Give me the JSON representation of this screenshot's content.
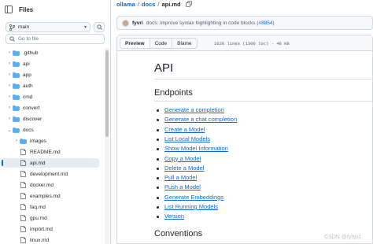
{
  "sidebar": {
    "title": "Files",
    "branch": "main",
    "goto_placeholder": "Go to file",
    "tree": [
      {
        "label": ".github",
        "type": "folder",
        "expanded": false,
        "indent": 0
      },
      {
        "label": "api",
        "type": "folder",
        "expanded": false,
        "indent": 0
      },
      {
        "label": "app",
        "type": "folder",
        "expanded": false,
        "indent": 0
      },
      {
        "label": "auth",
        "type": "folder",
        "expanded": false,
        "indent": 0
      },
      {
        "label": "cmd",
        "type": "folder",
        "expanded": false,
        "indent": 0
      },
      {
        "label": "convert",
        "type": "folder",
        "expanded": false,
        "indent": 0
      },
      {
        "label": "discover",
        "type": "folder",
        "expanded": false,
        "indent": 0
      },
      {
        "label": "docs",
        "type": "folder",
        "expanded": true,
        "indent": 0
      },
      {
        "label": "images",
        "type": "folder",
        "expanded": false,
        "indent": 1
      },
      {
        "label": "README.md",
        "type": "file",
        "indent": 1
      },
      {
        "label": "api.md",
        "type": "file",
        "indent": 1,
        "selected": true
      },
      {
        "label": "development.md",
        "type": "file",
        "indent": 1
      },
      {
        "label": "docker.md",
        "type": "file",
        "indent": 1
      },
      {
        "label": "examples.md",
        "type": "file",
        "indent": 1
      },
      {
        "label": "faq.md",
        "type": "file",
        "indent": 1
      },
      {
        "label": "gpu.md",
        "type": "file",
        "indent": 1
      },
      {
        "label": "import.md",
        "type": "file",
        "indent": 1
      },
      {
        "label": "linux.md",
        "type": "file",
        "indent": 1
      }
    ]
  },
  "breadcrumb": {
    "repo": "ollama",
    "folder": "docs",
    "file": "api.md",
    "sep": "/"
  },
  "commit": {
    "author": "fyvri",
    "message": "docs: improve syntax highlighting in code blocks (",
    "pr": "#8854",
    "close": ")"
  },
  "file_header": {
    "tabs": [
      "Preview",
      "Code",
      "Blame"
    ],
    "active_tab": "Preview",
    "meta": "1628 lines (1306 loc) · 48 KB"
  },
  "content": {
    "h1": "API",
    "h2_endpoints": "Endpoints",
    "toc": [
      "Generate a completion",
      "Generate a chat completion",
      "Create a Model",
      "List Local Models",
      "Show Model Information",
      "Copy a Model",
      "Delete a Model",
      "Pull a Model",
      "Push a Model",
      "Generate Embeddings",
      "List Running Models",
      "Version"
    ],
    "h2_conventions": "Conventions"
  },
  "watermark": "CSDN @fyhju1",
  "colors": {
    "link": "#0969da",
    "text": "#1f2328",
    "border": "#d0d7de",
    "selected_bg": "#e8ebef"
  }
}
